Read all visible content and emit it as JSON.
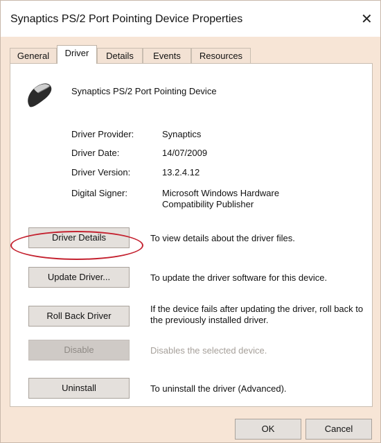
{
  "window": {
    "title": "Synaptics PS/2 Port Pointing Device Properties",
    "close_glyph": "✕"
  },
  "tabs": [
    {
      "label": "General"
    },
    {
      "label": "Driver",
      "active": true
    },
    {
      "label": "Details"
    },
    {
      "label": "Events"
    },
    {
      "label": "Resources"
    }
  ],
  "device": {
    "name": "Synaptics PS/2 Port Pointing Device",
    "icon": "mouse-icon"
  },
  "info": [
    {
      "label": "Driver Provider:",
      "value": "Synaptics"
    },
    {
      "label": "Driver Date:",
      "value": "14/07/2009"
    },
    {
      "label": "Driver Version:",
      "value": "13.2.4.12"
    },
    {
      "label": "Digital Signer:",
      "value": "Microsoft Windows Hardware Compatibility Publisher"
    }
  ],
  "actions": [
    {
      "label": "Driver Details",
      "description": "To view details about the driver files.",
      "enabled": true
    },
    {
      "label": "Update Driver...",
      "description": "To update the driver software for this device.",
      "enabled": true,
      "highlighted": true
    },
    {
      "label": "Roll Back Driver",
      "description": "If the device fails after updating the driver, roll back to the previously installed driver.",
      "enabled": true
    },
    {
      "label": "Disable",
      "description": "Disables the selected device.",
      "enabled": false
    },
    {
      "label": "Uninstall",
      "description": "To uninstall the driver (Advanced).",
      "enabled": true
    }
  ],
  "footer": {
    "ok_label": "OK",
    "cancel_label": "Cancel"
  },
  "colors": {
    "dialog_background": "#f7e5d6",
    "highlight_ring": "#c4212f"
  }
}
